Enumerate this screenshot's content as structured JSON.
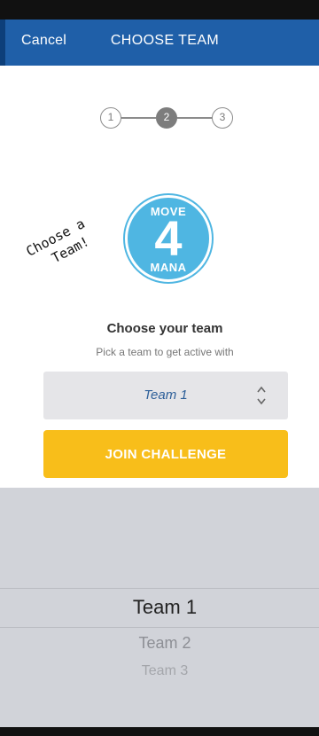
{
  "nav": {
    "cancel_label": "Cancel",
    "title": "CHOOSE TEAM"
  },
  "stepper": {
    "steps": [
      "1",
      "2",
      "3"
    ],
    "active_step": 2
  },
  "logo": {
    "top_text": "MOVE",
    "number": "4",
    "bottom_text": "MANA"
  },
  "annotation": {
    "line1": "Choose a",
    "line2": "Team!"
  },
  "content": {
    "title": "Choose your team",
    "subtitle": "Pick a team to get active with"
  },
  "team_select": {
    "value": "Team 1",
    "icon": "up-down-chevron-icon"
  },
  "join_button": {
    "label": "JOIN CHALLENGE"
  },
  "picker": {
    "options": [
      "Team 1",
      "Team 2",
      "Team 3"
    ],
    "selected": "Team 1"
  },
  "colors": {
    "nav_blue": "#1f5fa8",
    "accent_yellow": "#f8be1a",
    "logo_blue": "#4fb6e2",
    "picker_bg": "#d1d3d9"
  }
}
